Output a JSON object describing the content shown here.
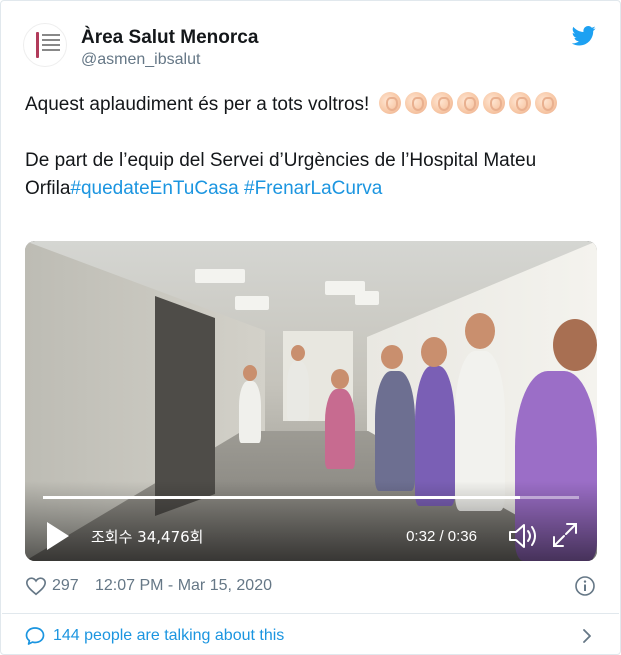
{
  "author": {
    "name": "Àrea Salut Menorca",
    "handle": "@asmen_ibsalut"
  },
  "tweet": {
    "line1": "Aquest aplaudiment és per a tots voltros!",
    "line2": "De part de l’equip del Servei d’Urgències de l’Hospital Mateu Orfila",
    "hashtag1": "#quedateEnTuCasa",
    "hashtag2": "#FrenarLaCurva",
    "emoji_count": 7
  },
  "video": {
    "views_label": "조회수 34,476회",
    "time": "0:32 / 0:36",
    "progress_fraction": 0.889
  },
  "meta": {
    "likes": "297",
    "timestamp": "12:07 PM - Mar 15, 2020"
  },
  "conversation": {
    "label": "144 people are talking about this"
  },
  "colors": {
    "brand_blue": "#1da1f2",
    "link_blue": "#1b95e0",
    "muted": "#657786",
    "text": "#14171a"
  },
  "icons": [
    "twitter-bird-icon",
    "clapping-hands-emoji",
    "play-icon",
    "volume-icon",
    "fullscreen-icon",
    "heart-icon",
    "info-icon",
    "speech-bubble-icon",
    "chevron-right-icon"
  ]
}
